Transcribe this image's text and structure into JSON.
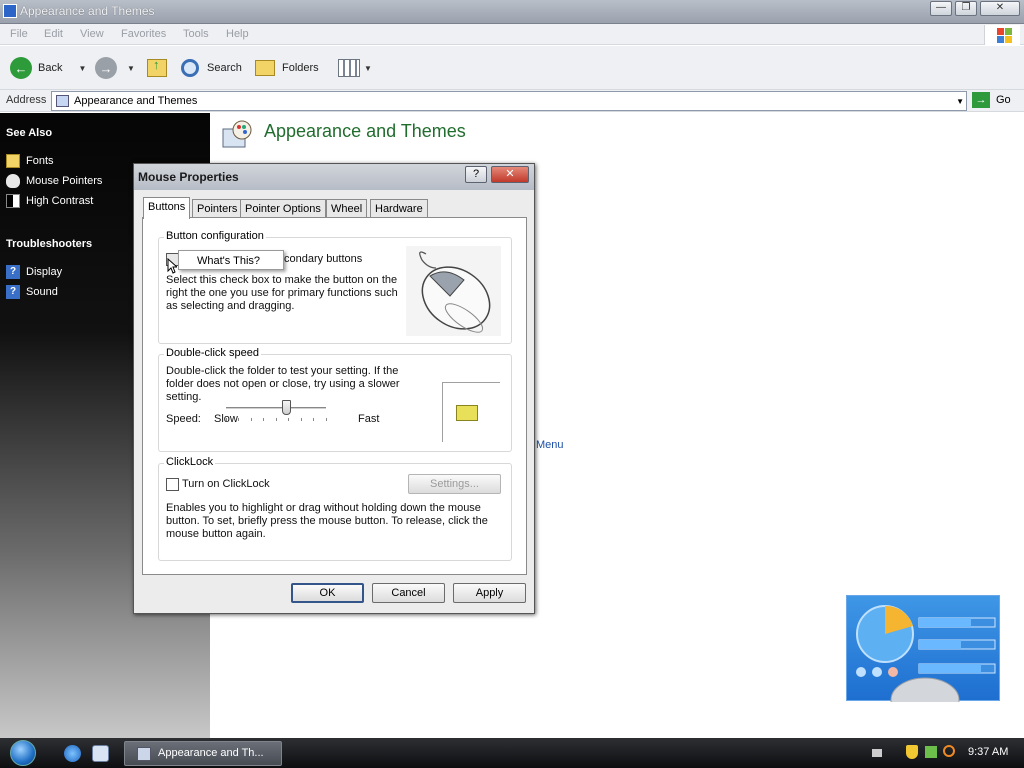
{
  "window": {
    "title": "Appearance and Themes",
    "controls": {
      "minimize": "—",
      "restore": "❐",
      "close": "✕"
    }
  },
  "menu": [
    "File",
    "Edit",
    "View",
    "Favorites",
    "Tools",
    "Help"
  ],
  "toolbar": {
    "back": "Back",
    "search": "Search",
    "folders": "Folders"
  },
  "address": {
    "label": "Address",
    "value": "Appearance and Themes",
    "go": "Go"
  },
  "sidebar": {
    "see_also_heading": "See Also",
    "see_also": [
      "Fonts",
      "Mouse Pointers",
      "High Contrast"
    ],
    "troubleshooters_heading": "Troubleshooters",
    "troubleshooters": [
      "Display",
      "Sound"
    ]
  },
  "content": {
    "title": "Appearance and Themes",
    "partial_link": "Menu"
  },
  "dialog": {
    "title": "Mouse Properties",
    "help_btn": "?",
    "close_btn": "✕",
    "tabs": [
      "Buttons",
      "Pointers",
      "Pointer Options",
      "Wheel",
      "Hardware"
    ],
    "active_tab": "Buttons",
    "button_config": {
      "label": "Button configuration",
      "checkbox_label": "condary buttons",
      "description": "Select this check box to make the button on the right the one you use for primary functions such as selecting and dragging."
    },
    "double_click": {
      "label": "Double-click speed",
      "description": "Double-click the folder to test your setting. If the folder does not open or close, try using a slower setting.",
      "speed_label": "Speed:",
      "slow": "Slow",
      "fast": "Fast",
      "slider_position": 0.6
    },
    "clicklock": {
      "label": "ClickLock",
      "checkbox_label": "Turn on ClickLock",
      "settings_btn": "Settings...",
      "description": "Enables you to highlight or drag without holding down the mouse button. To set, briefly press the mouse button. To release, click the mouse button again."
    },
    "buttons": {
      "ok": "OK",
      "cancel": "Cancel",
      "apply": "Apply"
    }
  },
  "context_menu": {
    "item": "What's This?"
  },
  "taskbar": {
    "task_label": "Appearance and Th...",
    "clock": "9:37 AM"
  },
  "colors": {
    "title_green": "#216d2e",
    "link_blue": "#1c4fa8"
  }
}
